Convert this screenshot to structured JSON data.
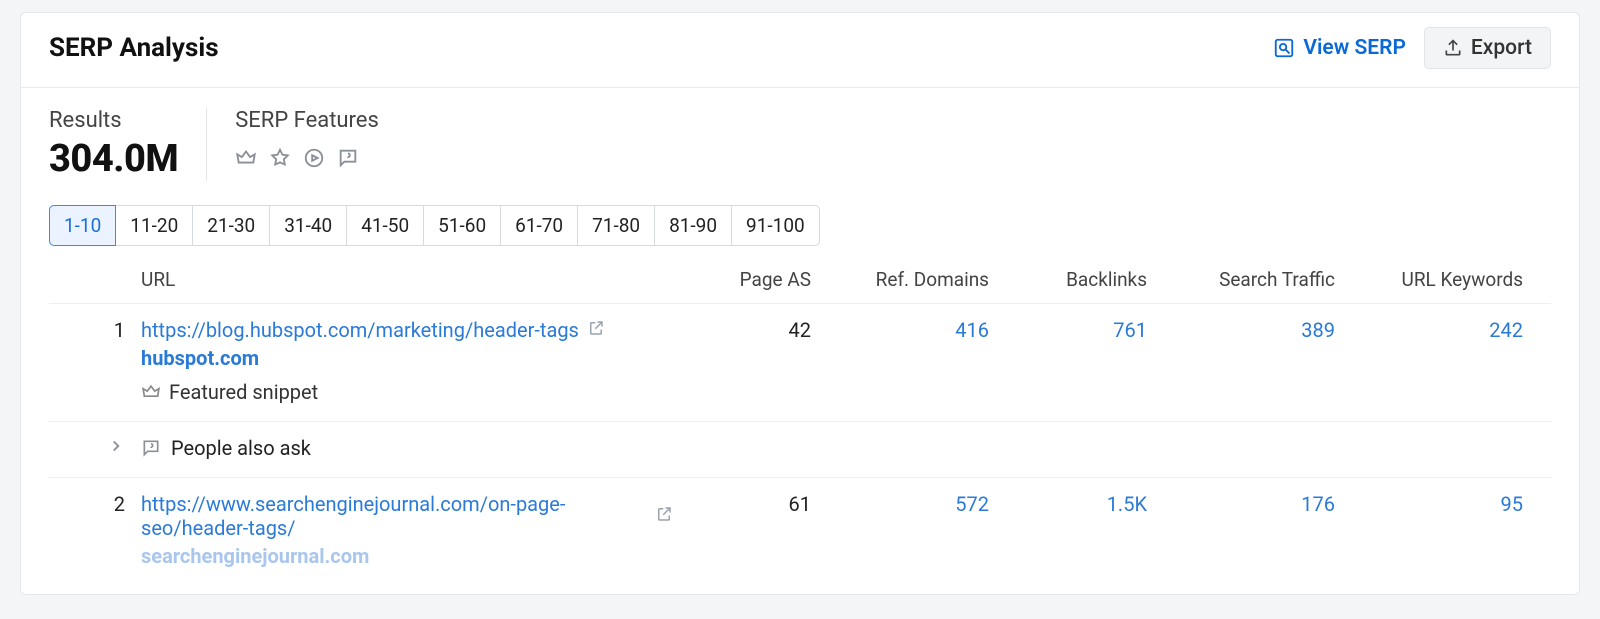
{
  "header": {
    "title": "SERP Analysis",
    "view_serp_label": "View SERP",
    "export_label": "Export"
  },
  "stats": {
    "results_label": "Results",
    "results_value": "304.0M",
    "features_label": "SERP Features"
  },
  "range_tabs": [
    {
      "label": "1-10",
      "active": true
    },
    {
      "label": "11-20"
    },
    {
      "label": "21-30"
    },
    {
      "label": "31-40"
    },
    {
      "label": "41-50"
    },
    {
      "label": "51-60"
    },
    {
      "label": "61-70"
    },
    {
      "label": "71-80"
    },
    {
      "label": "81-90"
    },
    {
      "label": "91-100"
    }
  ],
  "table": {
    "columns": {
      "url": "URL",
      "page_as": "Page AS",
      "ref_domains": "Ref. Domains",
      "backlinks": "Backlinks",
      "search_traffic": "Search Traffic",
      "url_keywords": "URL Keywords"
    },
    "rows": [
      {
        "rank": "1",
        "url": "https://blog.hubspot.com/marketing/header-tags",
        "domain": "hubspot.com",
        "feature_label": "Featured snippet",
        "page_as": "42",
        "ref_domains": "416",
        "backlinks": "761",
        "search_traffic": "389",
        "url_keywords": "242"
      },
      {
        "paa": true,
        "paa_label": "People also ask"
      },
      {
        "rank": "2",
        "url": "https://www.searchenginejournal.com/on-page-seo/header-tags/",
        "domain": "searchenginejournal.com",
        "domain_faded": true,
        "page_as": "61",
        "ref_domains": "572",
        "backlinks": "1.5K",
        "search_traffic": "176",
        "url_keywords": "95"
      }
    ]
  }
}
